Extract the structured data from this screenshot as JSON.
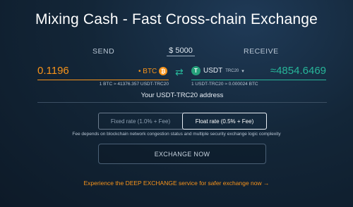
{
  "header": {
    "title": "Mixing Cash - Fast Cross-chain Exchange"
  },
  "labels": {
    "send": "SEND",
    "usd_amount": "$ 5000",
    "receive": "RECEIVE"
  },
  "send": {
    "amount": "0.1196",
    "coin": "• BTC",
    "coin_icon_letter": "₿",
    "rate": "1 BTC ≈ 41376.357 USDT-TRC20"
  },
  "swap": {
    "icon": "⇄"
  },
  "receive": {
    "coin": "USDT",
    "network": "TRC20",
    "coin_icon_letter": "T",
    "amount": "≈4854.6469",
    "rate": "1 USDT-TRC20 ≈ 0.000024 BTC"
  },
  "address": {
    "label": "Your USDT-TRC20 address"
  },
  "rate_toggle": {
    "fixed": "Fixed rate (1.0% + Fee)",
    "float": "Float rate (0.5% + Fee)"
  },
  "fee_note": "Fee depends on blockchain network congestion status and multiple security exchange logic complexity",
  "exchange_button": "EXCHANGE NOW",
  "deep_link": "Experience the DEEP EXCHANGE service for safer exchange now →",
  "colors": {
    "btc": "#f7931a",
    "usdt": "#27b599",
    "background": "#132638"
  }
}
